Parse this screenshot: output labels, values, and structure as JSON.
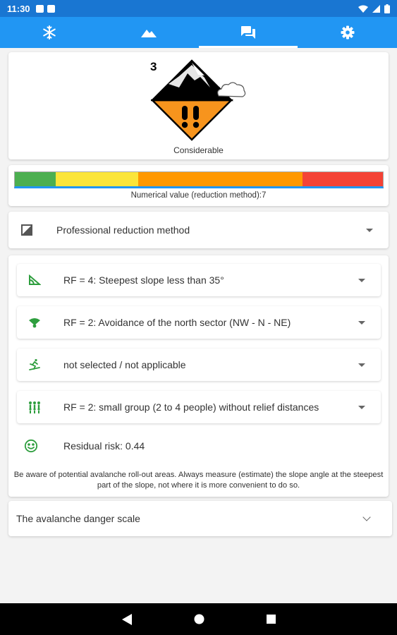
{
  "status_bar": {
    "time": "11:30"
  },
  "tabs": [
    {
      "name": "snowflake-icon",
      "active": false
    },
    {
      "name": "mountain-icon",
      "active": false
    },
    {
      "name": "chat-icon",
      "active": true
    },
    {
      "name": "gear-icon",
      "active": false
    }
  ],
  "danger": {
    "level": "3",
    "label": "Considerable"
  },
  "scale": {
    "colors": [
      "#4caf50",
      "#fbe53a",
      "#ff9800",
      "#f44336"
    ],
    "numerical_value_text": "Numerical value (reduction method):7",
    "value": 7
  },
  "method": {
    "label": "Professional reduction method"
  },
  "factors": [
    {
      "label": "RF = 4: Steepest slope less than 35°",
      "icon": "slope-angle-icon"
    },
    {
      "label": "RF = 2: Avoidance of the north sector (NW - N - NE)",
      "icon": "compass-sector-icon"
    },
    {
      "label": "not selected / not applicable",
      "icon": "skier-icon"
    },
    {
      "label": "RF = 2: small group (2 to 4 people) without relief distances",
      "icon": "group-icon"
    }
  ],
  "residual_risk": {
    "text": "Residual risk: 0.44",
    "icon": "smiley-icon"
  },
  "note": "Be aware of potential avalanche roll-out areas. Always measure (estimate) the slope angle at the steepest part of the slope, not where it is more convenient to do so.",
  "danger_scale_section": {
    "label": "The avalanche danger scale"
  },
  "colors": {
    "primary": "#2196f3",
    "primary_dark": "#1976d2",
    "icon_green": "#2e9e3e"
  }
}
